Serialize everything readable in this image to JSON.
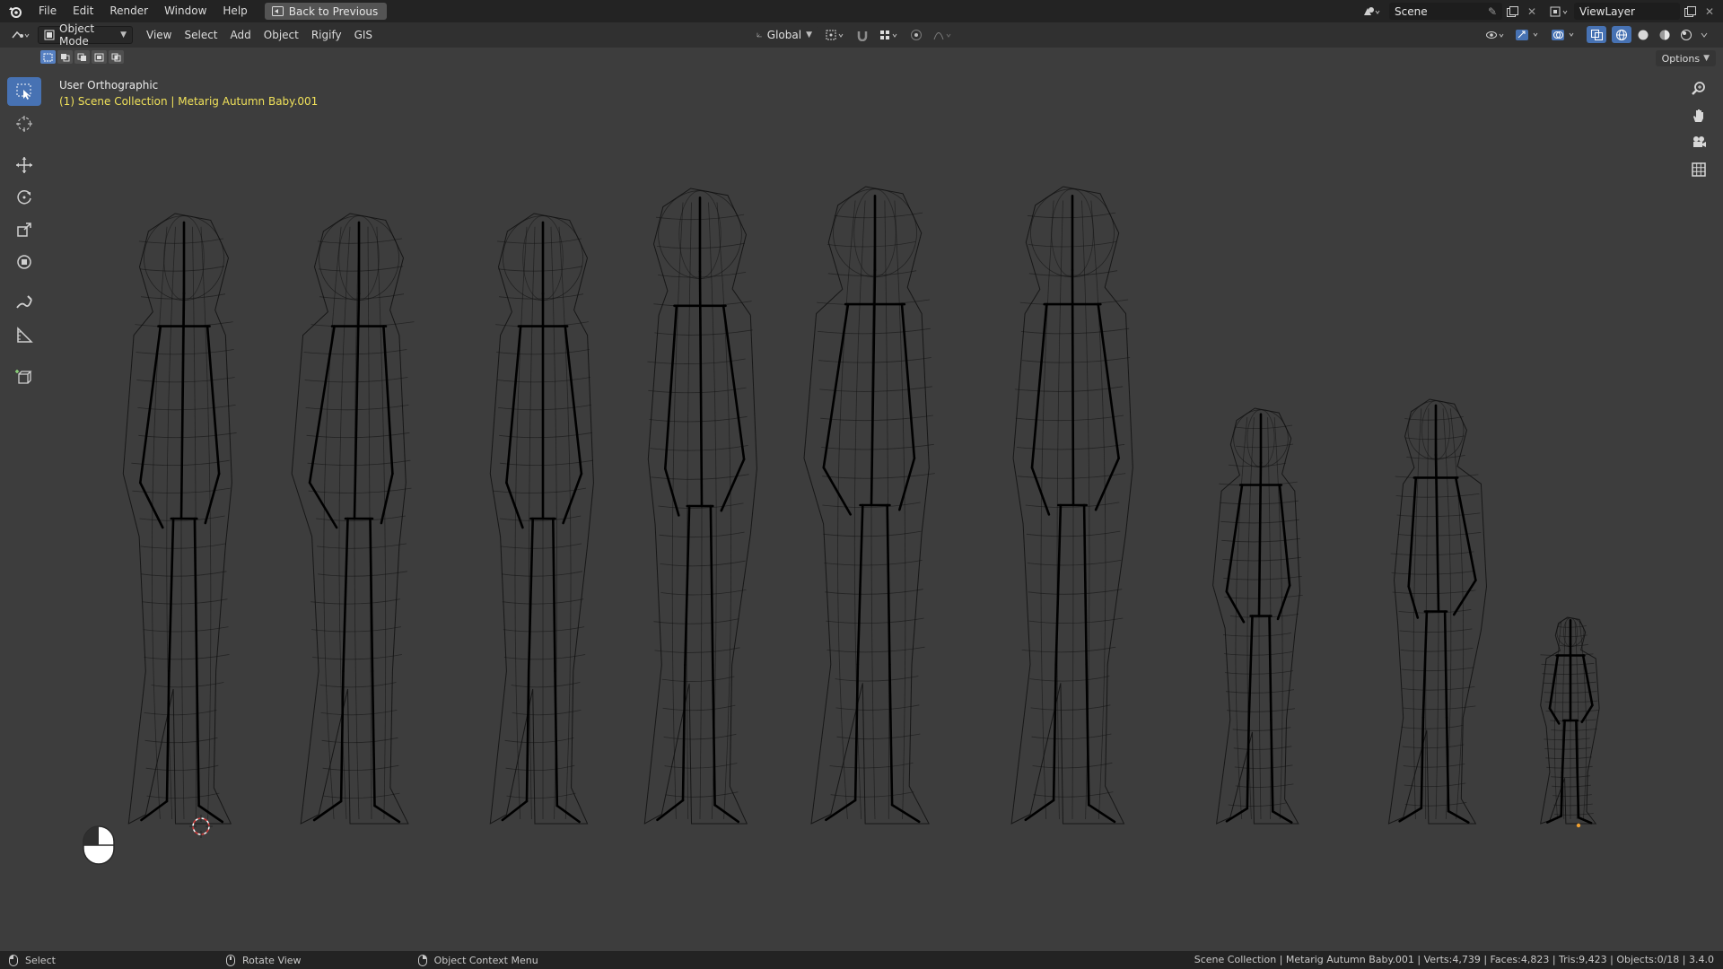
{
  "topbar": {
    "menu": [
      "File",
      "Edit",
      "Render",
      "Window",
      "Help"
    ],
    "back_label": "Back to Previous",
    "scene_name": "Scene",
    "view_layer": "ViewLayer"
  },
  "header": {
    "mode": "Object Mode",
    "menus": [
      "View",
      "Select",
      "Add",
      "Object",
      "Rigify",
      "GIS"
    ],
    "orientation": "Global",
    "options_label": "Options"
  },
  "viewport": {
    "view_name": "User Orthographic",
    "collection_info": "(1) Scene Collection | Metarig Autumn Baby.001",
    "wire_color": "#101010",
    "bone_color": "#000000",
    "info_color": "#f0e15a",
    "active_tool_color": "#4772b3"
  },
  "icons": {
    "toolbar": [
      "select-box-icon",
      "cursor-icon",
      "move-icon",
      "rotate-icon",
      "scale-icon",
      "transform-icon",
      "annotate-icon",
      "measure-icon",
      "add-cube-icon"
    ],
    "navigation": [
      "zoom-icon",
      "pan-hand-icon",
      "camera-icon",
      "grid-icon"
    ]
  },
  "statusbar": {
    "select": "Select",
    "rotate": "Rotate View",
    "context": "Object Context Menu",
    "stats": "Scene Collection | Metarig Autumn Baby.001 | Verts:4,739 | Faces:4,823 | Tris:9,423 | Objects:0/18 | 3.4.0"
  }
}
